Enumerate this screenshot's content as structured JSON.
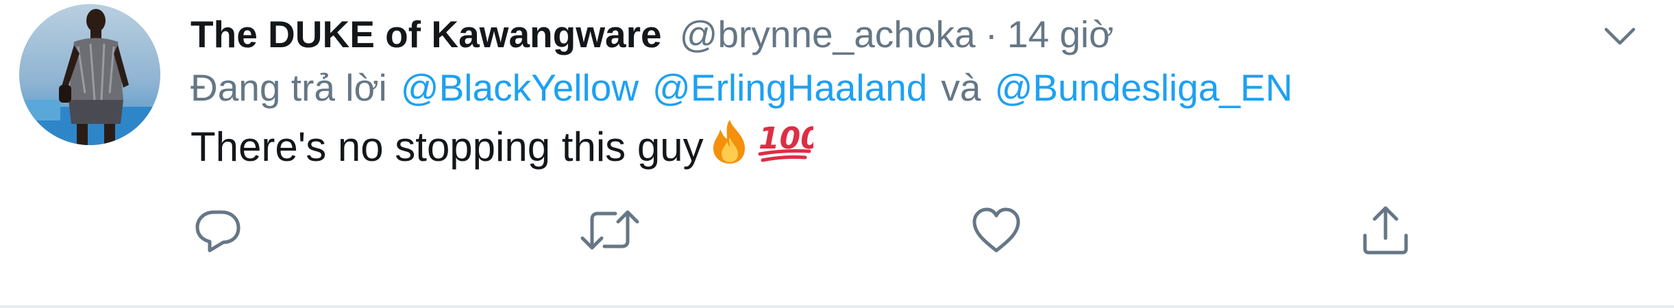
{
  "tweet": {
    "display_name": "The DUKE of Kawangware",
    "handle": "@brynne_achoka",
    "separator": "·",
    "time": "14 giờ",
    "replying_prefix": "Đang trả lời",
    "mentions": [
      "@BlackYellow",
      "@ErlingHaaland",
      "@Bundesliga_EN"
    ],
    "mention_conjunction": "và",
    "text": "There's no stopping this guy",
    "emojis": [
      "fire-emoji",
      "hundred-points-emoji"
    ]
  },
  "icons": {
    "caret": "chevron-down-icon",
    "reply": "reply-icon",
    "retweet": "retweet-icon",
    "like": "heart-icon",
    "share": "share-icon"
  },
  "colors": {
    "name": "#14171a",
    "secondary": "#657786",
    "mention": "#1da1f2",
    "divider": "#e6ecf0"
  }
}
